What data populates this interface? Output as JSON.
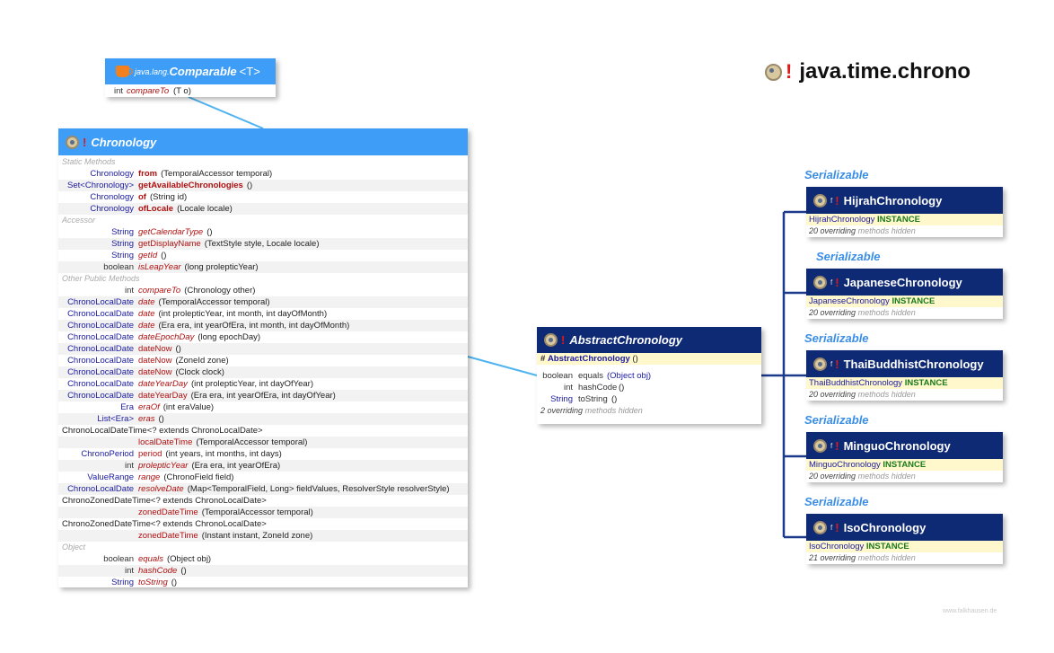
{
  "package_title": "java.time.chrono",
  "comparable": {
    "pkg": "java.lang.",
    "name": "Comparable",
    "generic": "<T>",
    "methods": [
      {
        "type": "int",
        "name": "compareTo",
        "params": "(T o)"
      }
    ]
  },
  "chronology": {
    "name": "Chronology",
    "sections": [
      {
        "label": "Static Methods",
        "rows": [
          {
            "type": "Chronology",
            "name": "from",
            "params": "(TemporalAccessor temporal)",
            "style": "b"
          },
          {
            "type": "Set<Chronology>",
            "name": "getAvailableChronologies",
            "params": "()",
            "style": "b"
          },
          {
            "type": "Chronology",
            "name": "of",
            "params": "(String id)",
            "style": "b"
          },
          {
            "type": "Chronology",
            "name": "ofLocale",
            "params": "(Locale locale)",
            "style": "b"
          }
        ]
      },
      {
        "label": "Accessor",
        "rows": [
          {
            "type": "String",
            "name": "getCalendarType",
            "params": "()",
            "style": "it"
          },
          {
            "type": "String",
            "name": "getDisplayName",
            "params": "(TextStyle style, Locale locale)",
            "style": ""
          },
          {
            "type": "String",
            "name": "getId",
            "params": "()",
            "style": "it"
          },
          {
            "type": "boolean",
            "name": "isLeapYear",
            "params": "(long prolepticYear)",
            "style": "it"
          }
        ]
      },
      {
        "label": "Other Public Methods",
        "rows": [
          {
            "type": "int",
            "name": "compareTo",
            "params": "(Chronology other)",
            "style": "it"
          },
          {
            "type": "ChronoLocalDate",
            "name": "date",
            "params": "(TemporalAccessor temporal)",
            "style": "it"
          },
          {
            "type": "ChronoLocalDate",
            "name": "date",
            "params": "(int prolepticYear, int month, int dayOfMonth)",
            "style": "it"
          },
          {
            "type": "ChronoLocalDate",
            "name": "date",
            "params": "(Era era, int yearOfEra, int month, int dayOfMonth)",
            "style": "it"
          },
          {
            "type": "ChronoLocalDate",
            "name": "dateEpochDay",
            "params": "(long epochDay)",
            "style": "it"
          },
          {
            "type": "ChronoLocalDate",
            "name": "dateNow",
            "params": "()",
            "style": ""
          },
          {
            "type": "ChronoLocalDate",
            "name": "dateNow",
            "params": "(ZoneId zone)",
            "style": ""
          },
          {
            "type": "ChronoLocalDate",
            "name": "dateNow",
            "params": "(Clock clock)",
            "style": ""
          },
          {
            "type": "ChronoLocalDate",
            "name": "dateYearDay",
            "params": "(int prolepticYear, int dayOfYear)",
            "style": "it"
          },
          {
            "type": "ChronoLocalDate",
            "name": "dateYearDay",
            "params": "(Era era, int yearOfEra, int dayOfYear)",
            "style": ""
          },
          {
            "type": "Era",
            "name": "eraOf",
            "params": "(int eraValue)",
            "style": "it"
          },
          {
            "type": "List<Era>",
            "name": "eras",
            "params": "()",
            "style": "it"
          },
          {
            "type": "",
            "wide": "ChronoLocalDateTime<? extends ChronoLocalDate>",
            "name": "",
            "params": "",
            "style": ""
          },
          {
            "type": "",
            "name": "localDateTime",
            "params": "(TemporalAccessor temporal)",
            "style": ""
          },
          {
            "type": "ChronoPeriod",
            "name": "period",
            "params": "(int years, int months, int days)",
            "style": ""
          },
          {
            "type": "int",
            "name": "prolepticYear",
            "params": "(Era era, int yearOfEra)",
            "style": "it"
          },
          {
            "type": "ValueRange",
            "name": "range",
            "params": "(ChronoField field)",
            "style": "it"
          },
          {
            "type": "ChronoLocalDate",
            "name": "resolveDate",
            "params": "(Map<TemporalField, Long> fieldValues, ResolverStyle resolverStyle)",
            "style": "it"
          },
          {
            "type": "",
            "wide": "ChronoZonedDateTime<? extends ChronoLocalDate>",
            "name": "",
            "params": "",
            "style": ""
          },
          {
            "type": "",
            "name": "zonedDateTime",
            "params": "(TemporalAccessor temporal)",
            "style": ""
          },
          {
            "type": "",
            "wide": "ChronoZonedDateTime<? extends ChronoLocalDate>",
            "name": "",
            "params": "",
            "style": ""
          },
          {
            "type": "",
            "name": "zonedDateTime",
            "params": "(Instant instant, ZoneId zone)",
            "style": ""
          }
        ]
      },
      {
        "label": "Object",
        "rows": [
          {
            "type": "boolean",
            "name": "equals",
            "params": "(Object obj)",
            "style": "it"
          },
          {
            "type": "int",
            "name": "hashCode",
            "params": "()",
            "style": "it"
          },
          {
            "type": "String",
            "name": "toString",
            "params": "()",
            "style": "it"
          }
        ]
      }
    ]
  },
  "abstract_chronology": {
    "name": "AbstractChronology",
    "ctor_mod": "#",
    "ctor": "AbstractChronology",
    "ctor_params": "()",
    "methods": [
      {
        "type": "boolean",
        "name": "equals",
        "params": "(Object obj)"
      },
      {
        "type": "int",
        "name": "hashCode",
        "params": "()"
      },
      {
        "type": "String",
        "name": "toString",
        "params": "()"
      }
    ],
    "hidden_count": "2 overriding",
    "hidden_label": "methods hidden"
  },
  "subclasses": [
    {
      "name": "HijrahChronology",
      "field_type": "HijrahChronology",
      "field": "INSTANCE",
      "hidden_count": "20 overriding",
      "serializable": "Serializable"
    },
    {
      "name": "JapaneseChronology",
      "field_type": "JapaneseChronology",
      "field": "INSTANCE",
      "hidden_count": "20 overriding",
      "serializable": "Serializable"
    },
    {
      "name": "ThaiBuddhistChronology",
      "field_type": "ThaiBuddhistChronology",
      "field": "INSTANCE",
      "hidden_count": "20 overriding",
      "serializable": "Serializable"
    },
    {
      "name": "MinguoChronology",
      "field_type": "MinguoChronology",
      "field": "INSTANCE",
      "hidden_count": "20 overriding",
      "serializable": "Serializable"
    },
    {
      "name": "IsoChronology",
      "field_type": "IsoChronology",
      "field": "INSTANCE",
      "hidden_count": "21 overriding",
      "serializable": "Serializable"
    }
  ],
  "hidden_label": "methods hidden",
  "final_marker": "f",
  "excl": "!",
  "footer": "www.falkhausen.de",
  "colors": {
    "light_header": "#3d9df7",
    "dark_header": "#0f2a75",
    "connector": "#4fb3f0",
    "subclass_connector": "#1b3a8c"
  }
}
